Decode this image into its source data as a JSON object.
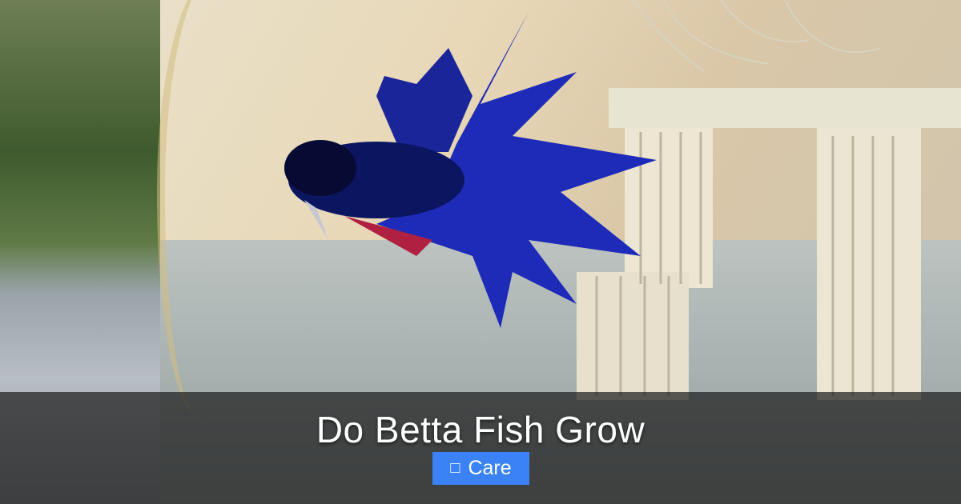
{
  "hero": {
    "title": "Do Betta Fish Grow",
    "category": {
      "label": "Care",
      "icon": "folder-icon",
      "icon_glyph": "□",
      "color": "#3b82f6"
    }
  }
}
